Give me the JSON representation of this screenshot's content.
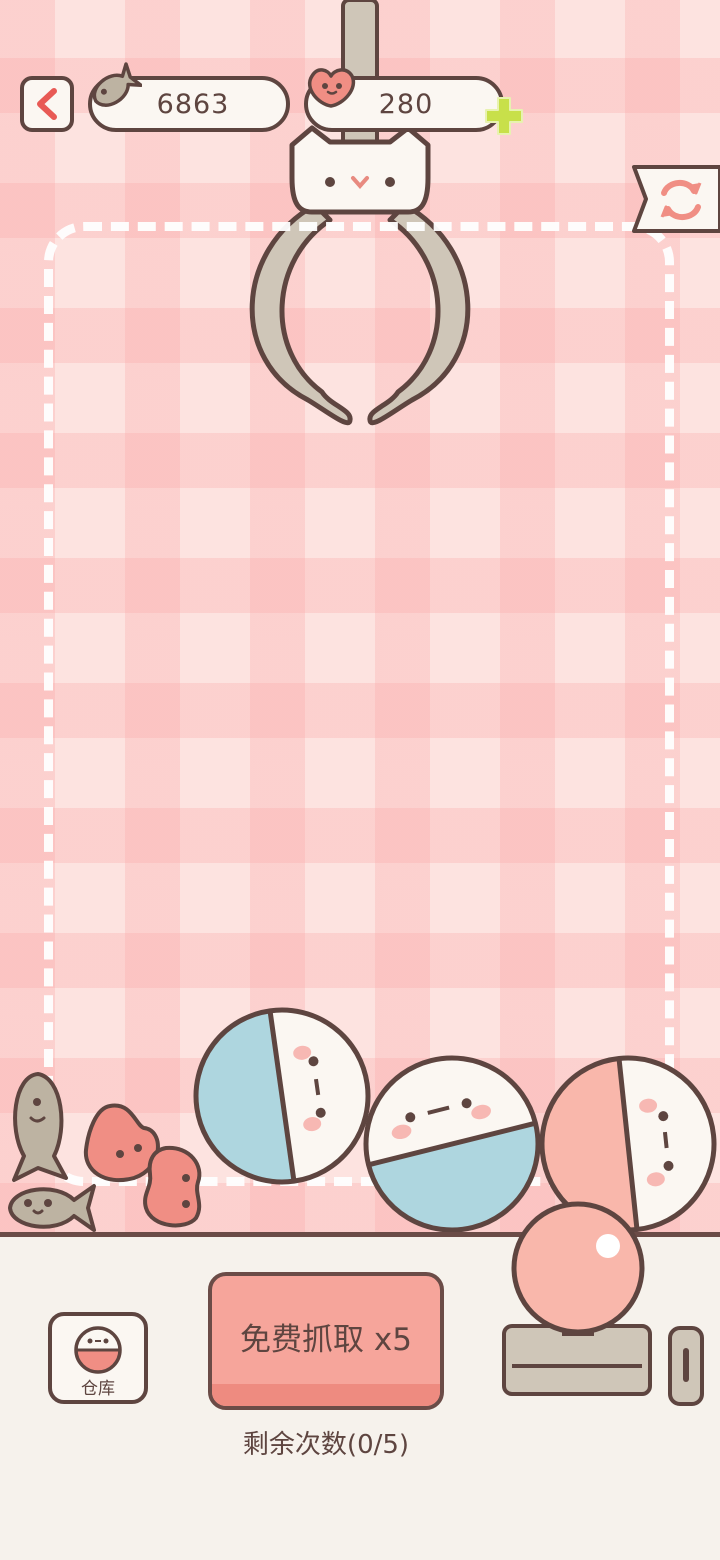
{
  "hud": {
    "fish_count": "6863",
    "heart_count": "280"
  },
  "icons": {
    "back": "chevron-left-icon",
    "fish": "fish-icon",
    "heart": "bean-heart-icon",
    "add": "plus-icon",
    "refresh": "refresh-icon",
    "storage": "capsule-icon"
  },
  "actions": {
    "storage_label": "仓库",
    "grab_label": "免费抓取 x5",
    "remaining_text": "剩余次数(0/5)"
  },
  "colors": {
    "background_pink": "#fde3e0",
    "outline_brown": "#5e4540",
    "button_coral": "#f6a59b",
    "accent_lime": "#c8e04a",
    "capsule_blue": "#aed6df",
    "capsule_pink": "#f9b7ab",
    "claw_gray": "#cfc6b8"
  }
}
